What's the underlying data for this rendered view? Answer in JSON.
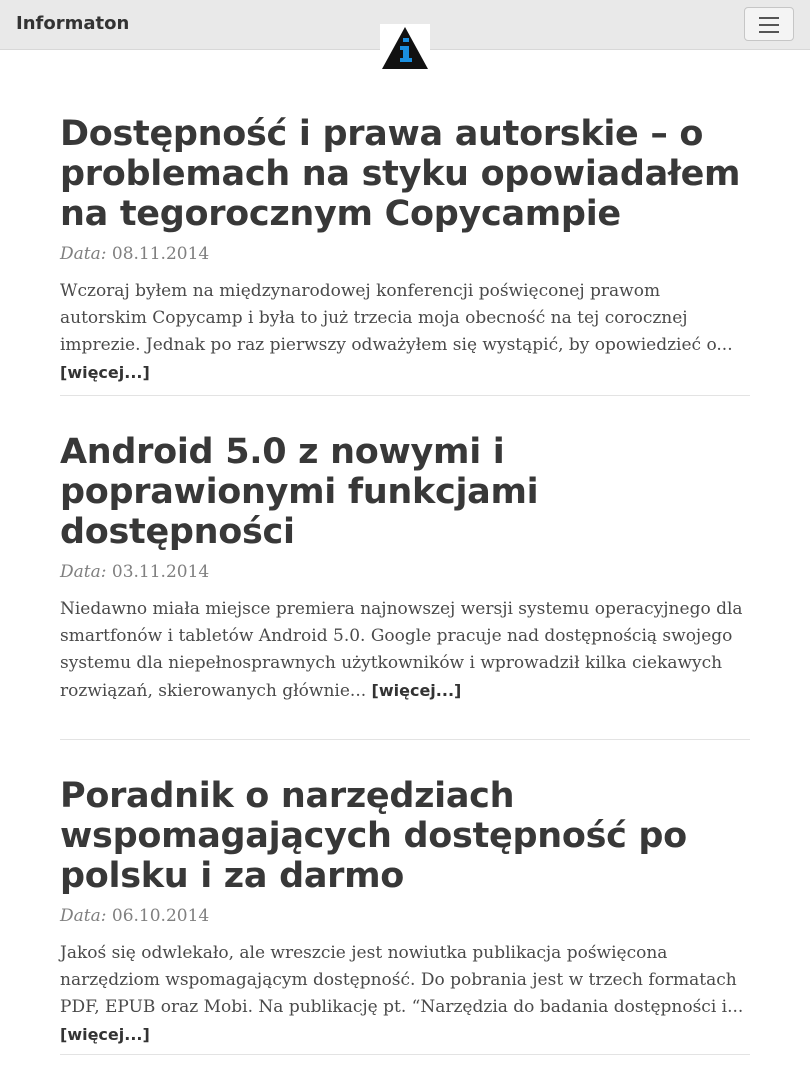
{
  "header": {
    "brand": "Informaton",
    "logo_icon": "info-triangle-logo-icon",
    "menu_icon": "hamburger-menu-icon"
  },
  "posts": [
    {
      "title": "Dostępność i prawa autorskie – o problemach na styku opowiadałem na tegorocznym Copycampie",
      "date_label": "Data:",
      "date": "08.11.2014",
      "excerpt": "Wczoraj byłem na międzynarodowej konferencji poświęconej prawom autorskim Copycamp i była to już trzecia moja obecność na tej corocznej imprezie. Jednak po raz pierwszy odważyłem się wystąpić, by opowiedzieć o...",
      "more": "[więcej...]"
    },
    {
      "title": "Android 5.0 z nowymi i poprawionymi funkcjami dostępności",
      "date_label": "Data:",
      "date": "03.11.2014",
      "excerpt": "Niedawno miała miejsce premiera najnowszej wersji systemu operacyjnego dla smartfonów i tabletów Android 5.0. Google pracuje nad dostępnością swojego systemu dla niepełnosprawnych użytkowników i wprowadził kilka ciekawych rozwiązań, skierowanych głównie...",
      "more": "[więcej...]"
    },
    {
      "title": "Poradnik o narzędziach wspomagających dostępność po polsku i za darmo",
      "date_label": "Data:",
      "date": "06.10.2014",
      "excerpt": "Jakoś się odwlekało, ale wreszcie jest nowiutka publikacja poświęcona narzędziom wspomagającym dostępność. Do pobrania jest w trzech formatach PDF, EPUB oraz Mobi. Na publikację pt. “Narzędzia do badania dostępności i...",
      "more": "[więcej...]"
    }
  ],
  "colors": {
    "navbar_bg": "#e9e9e9",
    "title_text": "#383838",
    "logo_blue": "#1a8fe0"
  }
}
